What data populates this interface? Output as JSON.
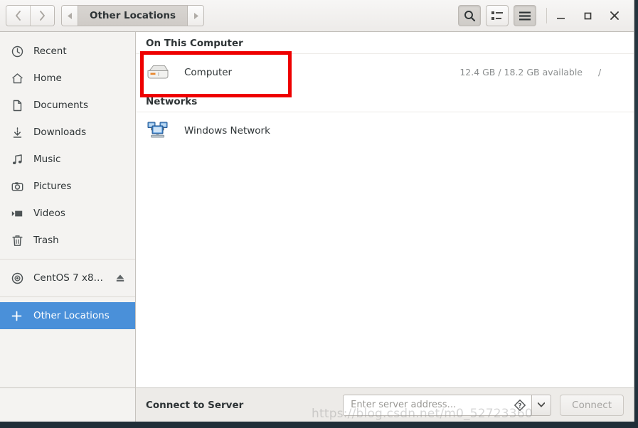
{
  "window": {
    "title": "Other Locations"
  },
  "header": {
    "back_icon": "chevron-left-icon",
    "forward_icon": "chevron-right-icon",
    "path_prev_icon": "path-left-arrow-icon",
    "path_next_icon": "path-right-arrow-icon",
    "path_crumb": "Other Locations",
    "search_icon": "search-icon",
    "view_icon": "list-view-icon",
    "menu_icon": "hamburger-menu-icon",
    "minimize": "minimize-icon",
    "maximize": "maximize-icon",
    "close": "close-icon"
  },
  "sidebar": {
    "items": [
      {
        "label": "Recent",
        "icon": "clock-icon"
      },
      {
        "label": "Home",
        "icon": "home-icon"
      },
      {
        "label": "Documents",
        "icon": "document-icon"
      },
      {
        "label": "Downloads",
        "icon": "download-icon"
      },
      {
        "label": "Music",
        "icon": "music-note-icon"
      },
      {
        "label": "Pictures",
        "icon": "camera-icon"
      },
      {
        "label": "Videos",
        "icon": "video-icon"
      },
      {
        "label": "Trash",
        "icon": "trash-icon"
      }
    ],
    "device": {
      "label": "CentOS 7 x8…",
      "icon": "optical-disc-icon",
      "eject_icon": "eject-icon"
    },
    "other": {
      "label": "Other Locations",
      "icon": "plus-icon",
      "selected": true
    }
  },
  "main": {
    "sections": [
      {
        "title": "On This Computer",
        "rows": [
          {
            "name": "Computer",
            "icon": "hard-drive-icon",
            "space": "12.4 GB / 18.2 GB available",
            "mount": "/"
          }
        ]
      },
      {
        "title": "Networks",
        "rows": [
          {
            "name": "Windows Network",
            "icon": "network-computers-icon",
            "space": "",
            "mount": ""
          }
        ]
      }
    ]
  },
  "actionbar": {
    "label": "Connect to Server",
    "placeholder": "Enter server address…",
    "help_icon": "help-icon",
    "dropdown_icon": "chevron-down-icon",
    "connect_label": "Connect"
  },
  "watermark": {
    "text": "https://blog.csdn.net/m0_52723360"
  },
  "colors": {
    "selection": "#4a90d9",
    "annotation": "#ee0000",
    "sidebar_bg": "#f4f3f1"
  }
}
